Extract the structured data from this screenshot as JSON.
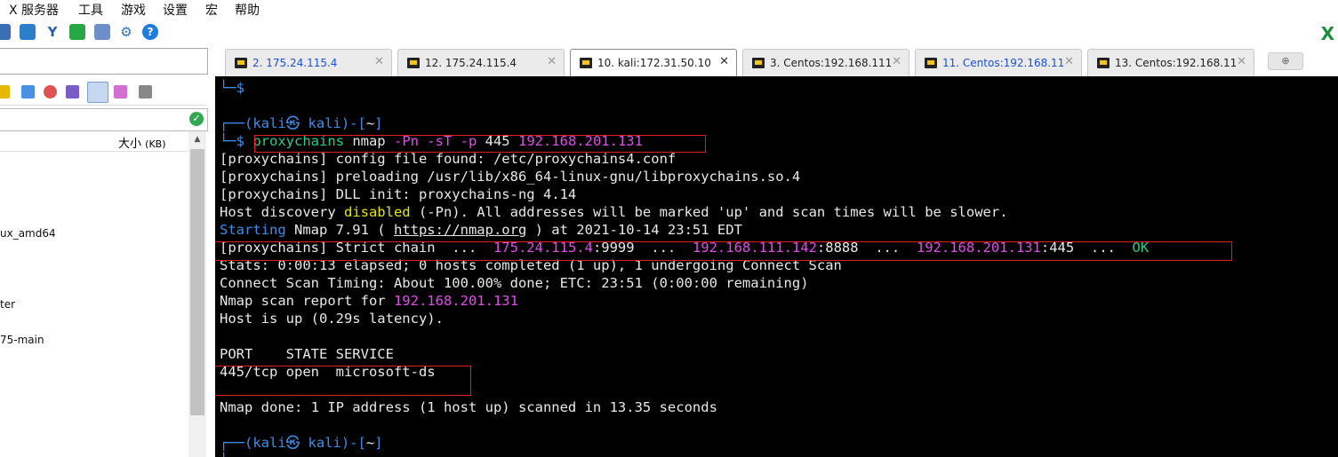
{
  "menubar": {
    "items": [
      "X 服务器",
      "工具",
      "游戏",
      "设置",
      "宏",
      "帮助"
    ]
  },
  "tabs": [
    {
      "label": "2. 175.24.115.4",
      "blue": true
    },
    {
      "label": "12. 175.24.115.4",
      "blue": false
    },
    {
      "label": "10. kali:172.31.50.10",
      "blue": false,
      "active": true
    },
    {
      "label": "3. Centos:192.168.111",
      "blue": false
    },
    {
      "label": "11. Centos:192.168.111",
      "blue": true
    },
    {
      "label": "13. Centos:192.168.111",
      "blue": false
    }
  ],
  "tab_close": "✕",
  "left_panel": {
    "size_header": "大小",
    "size_unit": "(KB)",
    "files": [
      "ux_amd64",
      "ter",
      "75-main"
    ]
  },
  "terminal": {
    "lines": [
      [
        {
          "t": "└─$",
          "c": "c-blue"
        }
      ],
      [],
      [
        {
          "t": "┌──(",
          "c": "c-blue"
        },
        {
          "t": "kali㉿ kali",
          "c": "c-kali"
        },
        {
          "t": ")-[",
          "c": "c-blue"
        },
        {
          "t": "~",
          "c": "c-wht"
        },
        {
          "t": "]",
          "c": "c-blue"
        }
      ],
      [
        {
          "t": "└─$ ",
          "c": "c-blue"
        },
        {
          "t": "proxychains",
          "c": "c-grn"
        },
        {
          "t": " nmap ",
          "c": "c-wht"
        },
        {
          "t": "-Pn -sT -p",
          "c": "c-mag"
        },
        {
          "t": " 445 ",
          "c": "c-wht"
        },
        {
          "t": "192.168.201.131",
          "c": "c-mag"
        }
      ],
      [
        {
          "t": "[proxychains] config file found: /etc/proxychains4.conf",
          "c": "c-wht"
        }
      ],
      [
        {
          "t": "[proxychains] preloading /usr/lib/x86_64-linux-gnu/libproxychains.so.4",
          "c": "c-wht"
        }
      ],
      [
        {
          "t": "[proxychains] DLL init: proxychains-ng 4.14",
          "c": "c-wht"
        }
      ],
      [
        {
          "t": "Host discovery ",
          "c": "c-wht"
        },
        {
          "t": "disabled",
          "c": "c-yel"
        },
        {
          "t": " (-Pn). All addresses will be marked 'up' and scan times will be slower.",
          "c": "c-wht"
        }
      ],
      [
        {
          "t": "Starting",
          "c": "c-blue"
        },
        {
          "t": " Nmap 7.91 ( ",
          "c": "c-wht"
        },
        {
          "t": "https://nmap.org",
          "c": "c-wht link"
        },
        {
          "t": " ) at 2021-10-14 23:51 EDT",
          "c": "c-wht"
        }
      ],
      [
        {
          "t": "[proxychains] Strict chain  ...  ",
          "c": "c-wht"
        },
        {
          "t": "175.24.115.4",
          "c": "c-mag"
        },
        {
          "t": ":9999  ...  ",
          "c": "c-wht"
        },
        {
          "t": "192.168.111.142",
          "c": "c-mag"
        },
        {
          "t": ":8888  ...  ",
          "c": "c-wht"
        },
        {
          "t": "192.168.201.131",
          "c": "c-mag"
        },
        {
          "t": ":445  ...  ",
          "c": "c-wht"
        },
        {
          "t": "OK",
          "c": "c-grn"
        }
      ],
      [
        {
          "t": "Stats: 0:00:13 elapsed; 0 hosts completed (1 up), 1 undergoing Connect Scan",
          "c": "c-wht"
        }
      ],
      [
        {
          "t": "Connect Scan Timing: About 100.00% done; ETC: 23:51 (0:00:00 remaining)",
          "c": "c-wht"
        }
      ],
      [
        {
          "t": "Nmap scan report for ",
          "c": "c-wht"
        },
        {
          "t": "192.168.201.131",
          "c": "c-mag"
        }
      ],
      [
        {
          "t": "Host is up (0.29s latency).",
          "c": "c-wht"
        }
      ],
      [],
      [
        {
          "t": "PORT    STATE SERVICE",
          "c": "c-wht"
        }
      ],
      [
        {
          "t": "445/tcp open  microsoft-ds",
          "c": "c-wht"
        }
      ],
      [],
      [
        {
          "t": "Nmap done: 1 IP address (1 host up) scanned in 13.35 seconds",
          "c": "c-wht"
        }
      ],
      [],
      [
        {
          "t": "┌──(",
          "c": "c-blue"
        },
        {
          "t": "kali㉿ kali",
          "c": "c-kali"
        },
        {
          "t": ")-[",
          "c": "c-blue"
        },
        {
          "t": "~",
          "c": "c-wht"
        },
        {
          "t": "]",
          "c": "c-blue"
        }
      ],
      [
        {
          "t": "└─",
          "c": "c-blue"
        }
      ]
    ]
  }
}
